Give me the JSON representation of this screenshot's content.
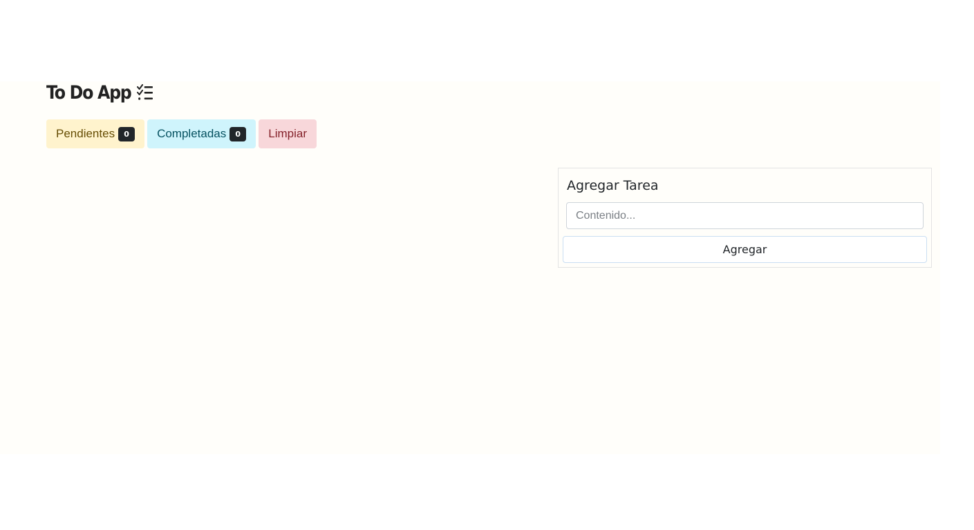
{
  "app": {
    "title": "To Do App",
    "title_icon": "list-check-icon"
  },
  "toolbar": {
    "pending_label": "Pendientes",
    "pending_count": "0",
    "completed_label": "Completadas",
    "completed_count": "0",
    "clear_label": "Limpiar"
  },
  "add_task": {
    "heading": "Agregar Tarea",
    "input_placeholder": "Contenido...",
    "input_value": "",
    "submit_label": "Agregar"
  },
  "colors": {
    "pending_bg": "#fff3cd",
    "completed_bg": "#cff4fc",
    "clear_bg": "#f8d7da",
    "badge_bg": "#212529"
  }
}
